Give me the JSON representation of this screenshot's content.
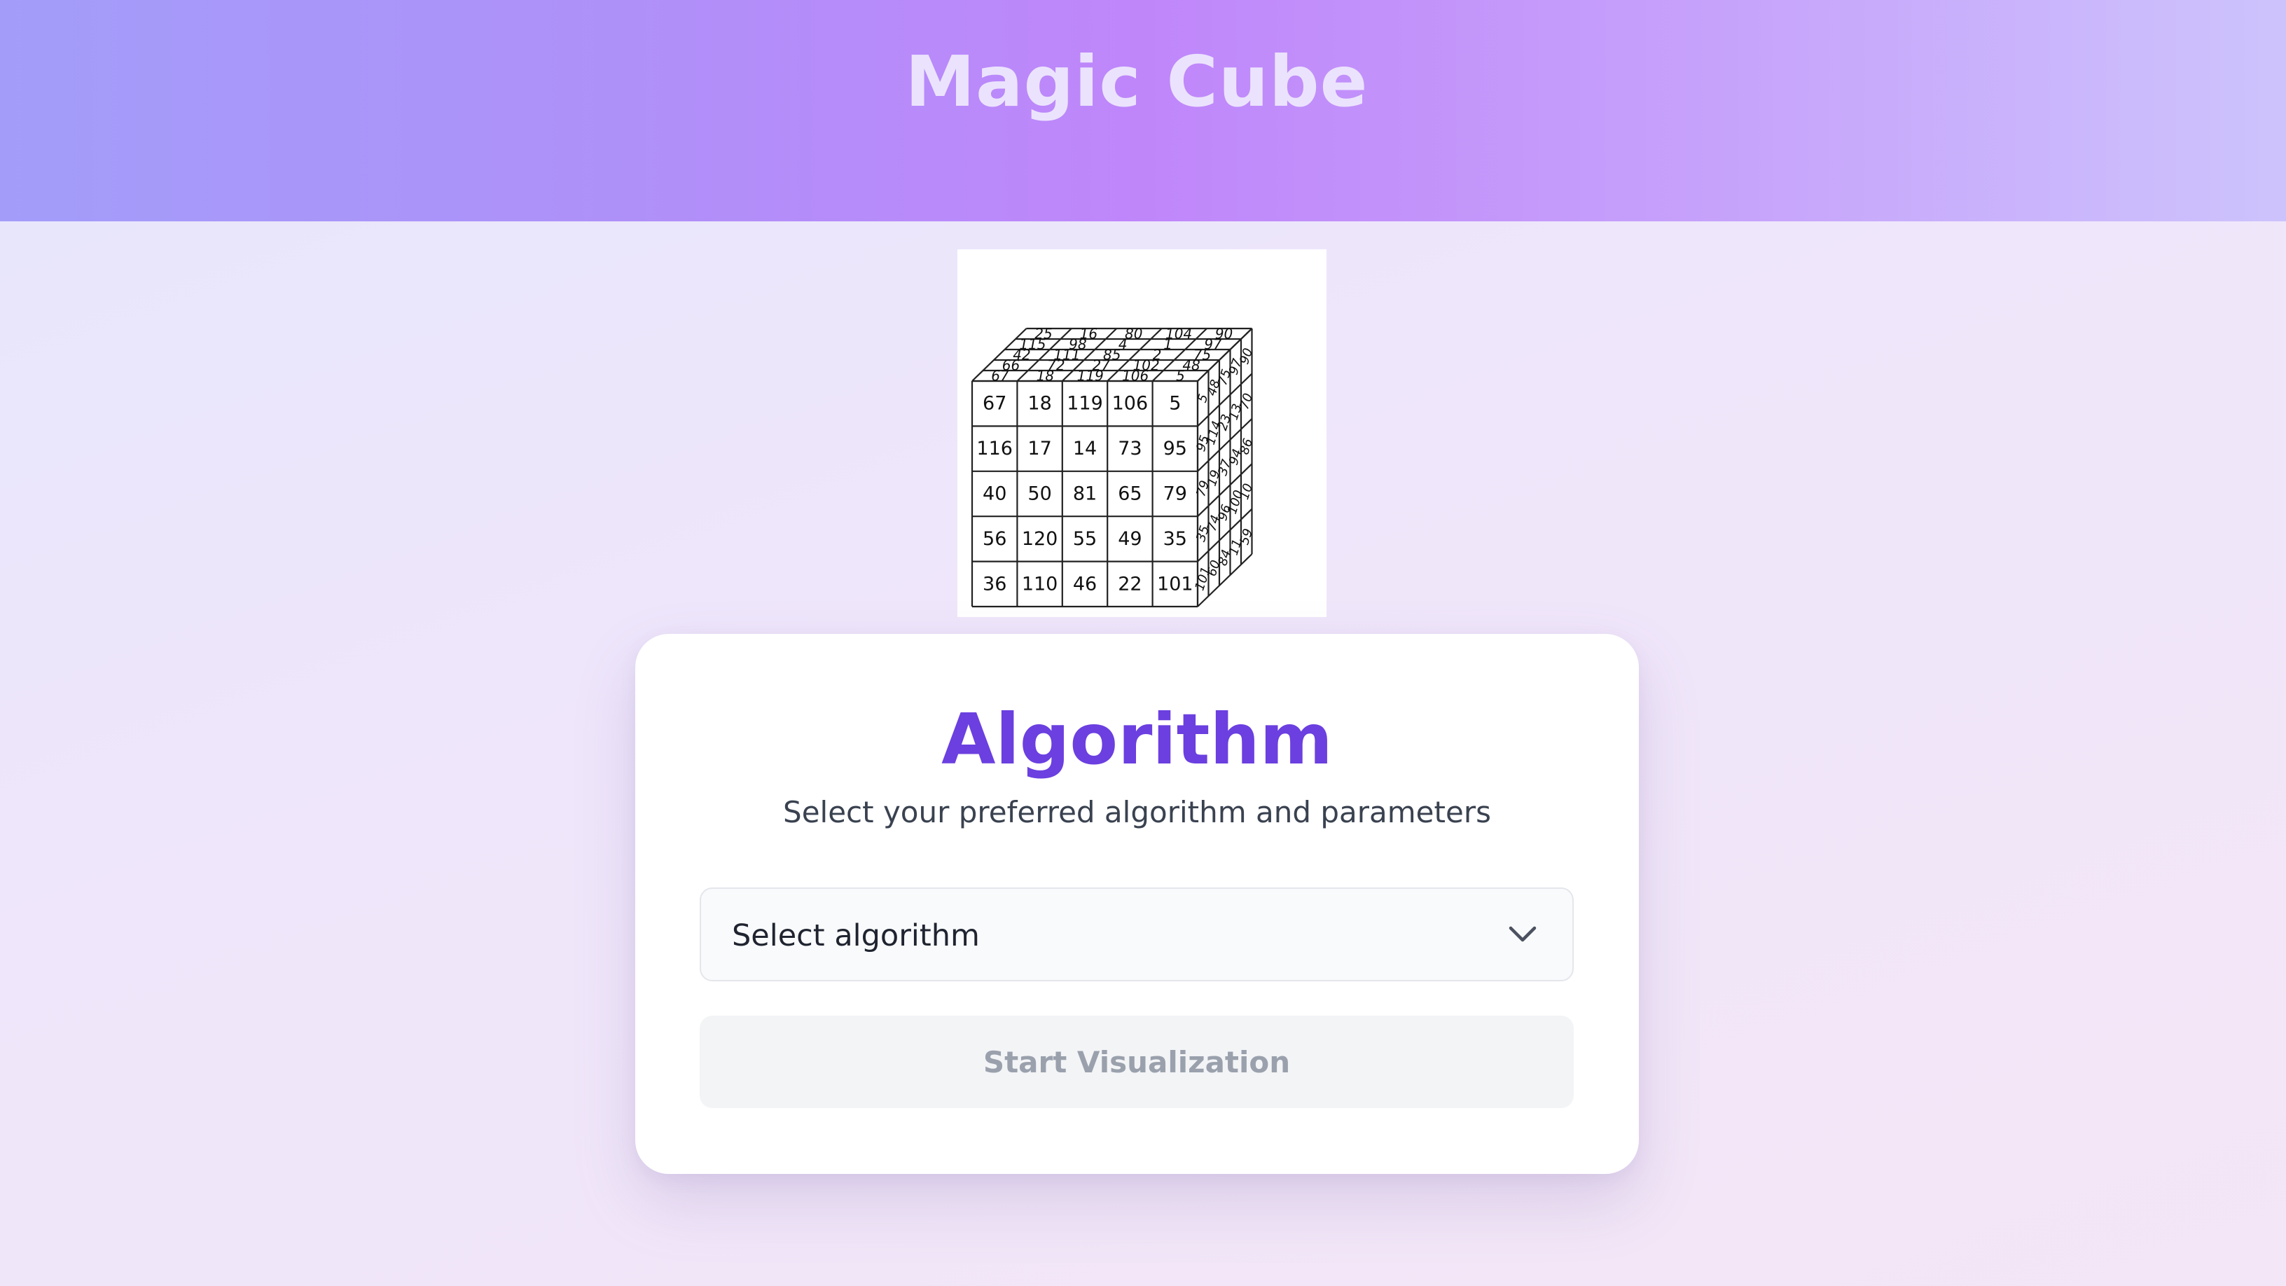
{
  "header": {
    "title": "Magic Cube"
  },
  "cube_image": {
    "top_rows": [
      [
        "25",
        "16",
        "80",
        "104",
        "90"
      ],
      [
        "115",
        "98",
        "4",
        "1",
        "97"
      ],
      [
        "42",
        "111",
        "85",
        "2",
        "75"
      ],
      [
        "66",
        "72",
        "27",
        "102",
        "48"
      ],
      [
        "67",
        "18",
        "119",
        "106",
        "5"
      ]
    ],
    "front_rows": [
      [
        "67",
        "18",
        "119",
        "106",
        "5"
      ],
      [
        "116",
        "17",
        "14",
        "73",
        "95"
      ],
      [
        "40",
        "50",
        "81",
        "65",
        "79"
      ],
      [
        "56",
        "120",
        "55",
        "49",
        "35"
      ],
      [
        "36",
        "110",
        "46",
        "22",
        "101"
      ]
    ],
    "side_columns": [
      [
        "5",
        "95",
        "79",
        "35",
        "101"
      ],
      [
        "48",
        "114",
        "19",
        "74",
        "60"
      ],
      [
        "75",
        "23",
        "37",
        "96",
        "84"
      ],
      [
        "97",
        "13",
        "94",
        "100",
        "11"
      ],
      [
        "90",
        "70",
        "86",
        "10",
        "59"
      ]
    ]
  },
  "card": {
    "title": "Algorithm",
    "subtitle": "Select your preferred algorithm and parameters",
    "select_value": "Select algorithm",
    "start_button": "Start Visualization"
  },
  "icons": {
    "dropdown": "chevron-down-icon"
  },
  "colors": {
    "accent": "#6b3fe0",
    "header_title": "#ebe3fd",
    "button_disabled_bg": "#f3f4f6",
    "button_disabled_text": "#9aa1ad"
  }
}
